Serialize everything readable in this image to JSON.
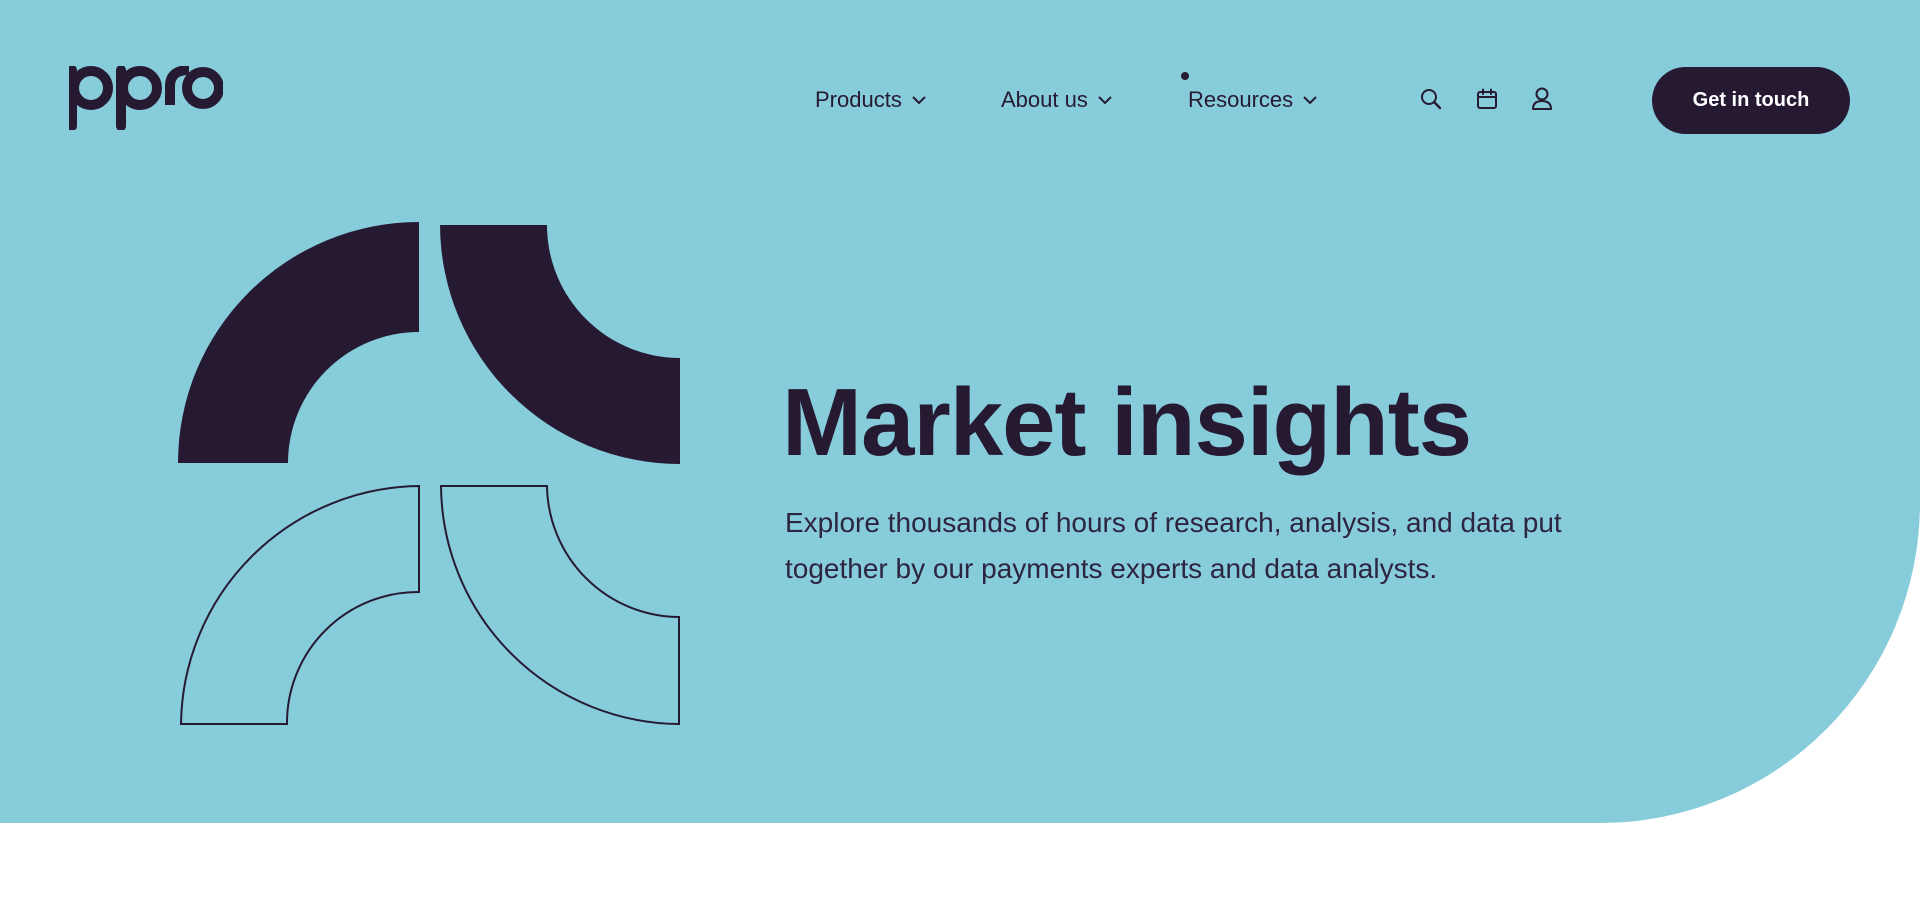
{
  "brand": {
    "logo_text": "ppro"
  },
  "nav": {
    "items": [
      {
        "label": "Products"
      },
      {
        "label": "About us"
      },
      {
        "label": "Resources"
      }
    ]
  },
  "icons": {
    "search": "search-icon",
    "calendar": "calendar-icon",
    "account": "user-icon",
    "chevron": "chevron-down-icon"
  },
  "cta": {
    "label": "Get in touch"
  },
  "hero": {
    "title": "Market insights",
    "subtitle": "Explore thousands of hours of research, analysis, and data put together by our payments experts and data analysts."
  },
  "colors": {
    "hero_background": "#87ccdb",
    "ink": "#261a33",
    "page_background": "#ffffff",
    "cta_text": "#ffffff"
  }
}
